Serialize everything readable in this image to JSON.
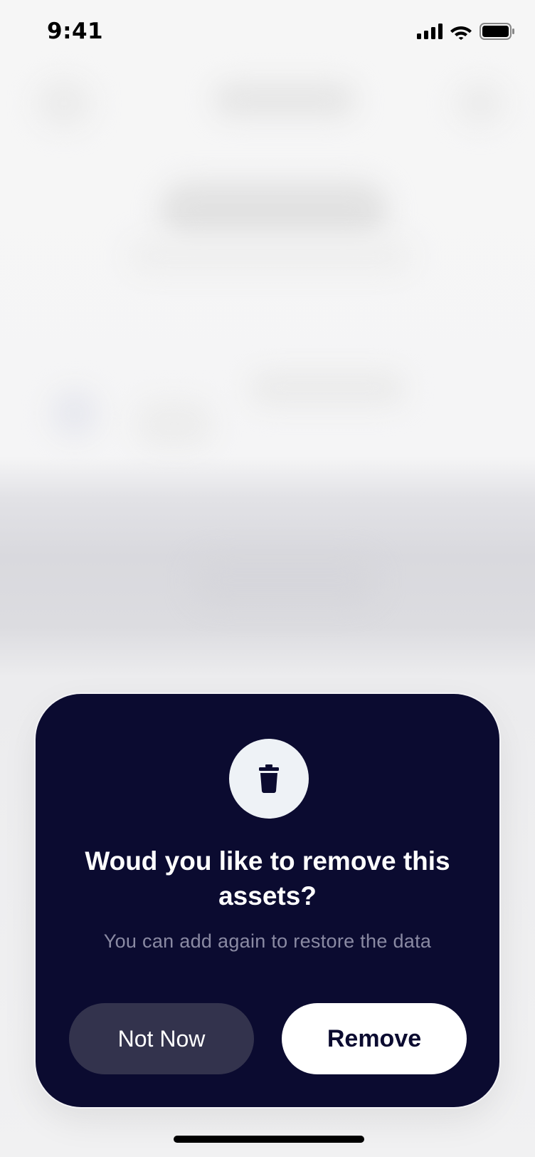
{
  "status_bar": {
    "time": "9:41",
    "icons": [
      "signal-icon",
      "wifi-icon",
      "battery-icon"
    ]
  },
  "dialog": {
    "icon": "trash-icon",
    "title": "Woud you like to remove this assets?",
    "subtitle": "You can add again to restore the data",
    "secondary_button": "Not Now",
    "primary_button": "Remove"
  },
  "colors": {
    "dialog_background": "#0b0b30",
    "secondary_button_background": "#33334d",
    "primary_button_background": "#ffffff",
    "subtitle_text": "#8a8aa3"
  }
}
